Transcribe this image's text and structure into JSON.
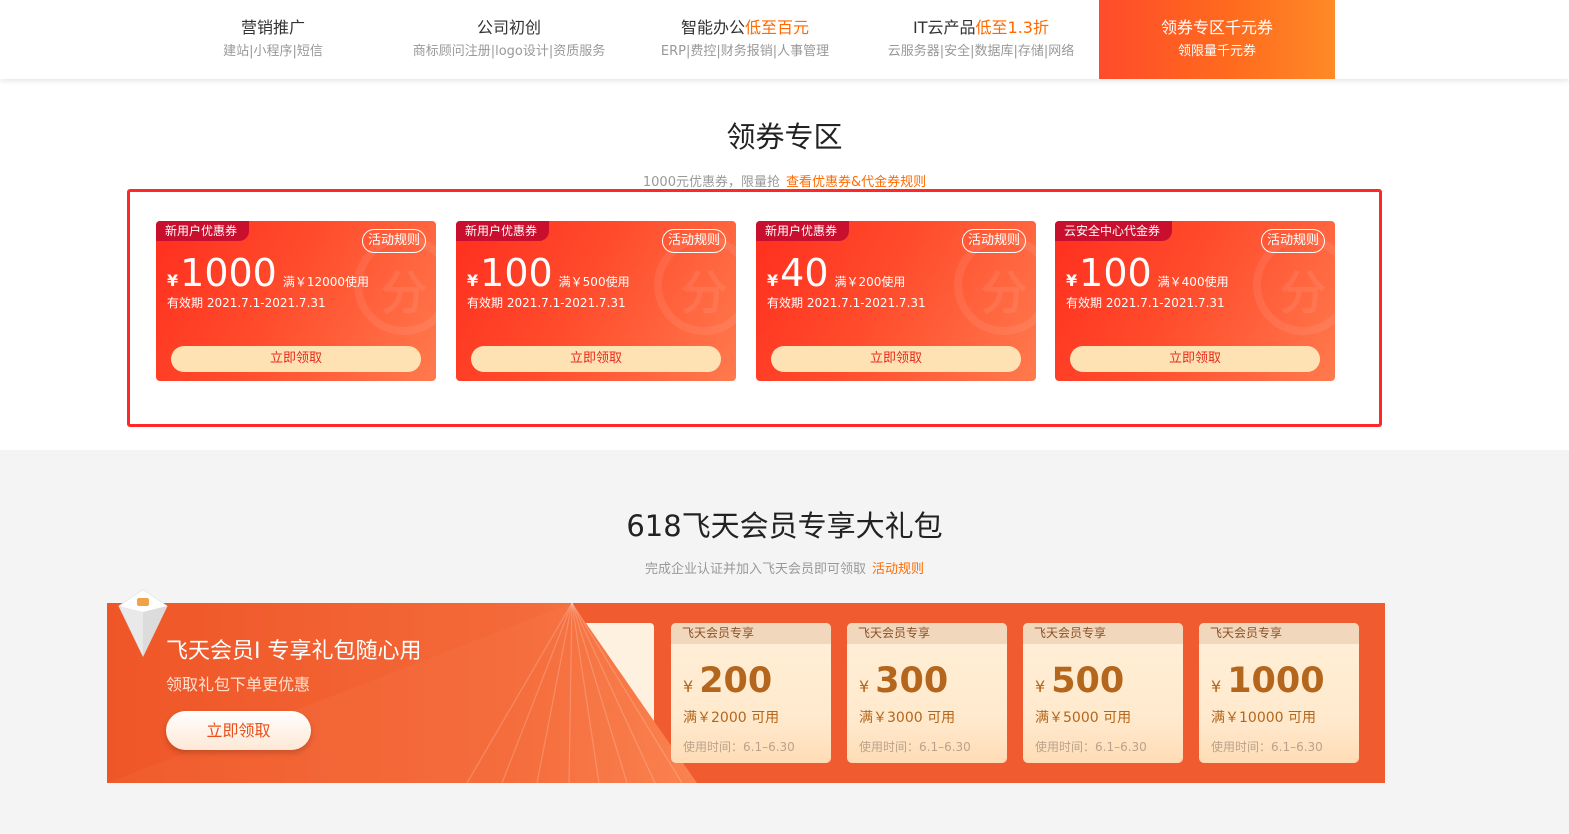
{
  "nav": {
    "items": [
      {
        "title": "营销推广",
        "highlight": "",
        "sub": "建站|小程序|短信"
      },
      {
        "title": "公司初创",
        "highlight": "",
        "sub": "商标顾问注册|logo设计|资质服务"
      },
      {
        "title": "智能办公",
        "highlight": "低至百元",
        "sub": "ERP|费控|财务报销|人事管理"
      },
      {
        "title": "IT云产品",
        "highlight": "低至1.3折",
        "sub": "云服务器|安全|数据库|存储|网络"
      },
      {
        "title": "领券专区千元券",
        "highlight": "",
        "sub": "领限量千元券"
      }
    ],
    "active_index": 4
  },
  "coupon_section": {
    "title": "领券专区",
    "subtitle": "1000元优惠券，限量抢",
    "rules_link": "查看优惠券&代金券规则"
  },
  "coupons": [
    {
      "tag": "新用户优惠券",
      "rule": "活动规则",
      "currency": "¥",
      "amount": "1000",
      "condition": "满￥12000使用",
      "valid": "有效期 2021.7.1-2021.7.31",
      "button": "立即领取"
    },
    {
      "tag": "新用户优惠券",
      "rule": "活动规则",
      "currency": "¥",
      "amount": "100",
      "condition": "满￥500使用",
      "valid": "有效期 2021.7.1-2021.7.31",
      "button": "立即领取"
    },
    {
      "tag": "新用户优惠券",
      "rule": "活动规则",
      "currency": "¥",
      "amount": "40",
      "condition": "满￥200使用",
      "valid": "有效期 2021.7.1-2021.7.31",
      "button": "立即领取"
    },
    {
      "tag": "云安全中心代金券",
      "rule": "活动规则",
      "currency": "¥",
      "amount": "100",
      "condition": "满￥400使用",
      "valid": "有效期 2021.7.1-2021.7.31",
      "button": "立即领取"
    }
  ],
  "member_section": {
    "title": "618飞天会员专享大礼包",
    "subtitle": "完成企业认证并加入飞天会员即可领取",
    "rules_link": "活动规则"
  },
  "banner": {
    "title": "飞天会员Ⅰ 专享礼包随心用",
    "subtitle": "领取礼包下单更优惠",
    "button": "立即领取"
  },
  "member_cards": [
    {
      "header": "飞天会员专享",
      "currency": "¥",
      "amount": "200",
      "condition": "满￥2000 可用",
      "time": "使用时间：6.1–6.30"
    },
    {
      "header": "飞天会员专享",
      "currency": "¥",
      "amount": "300",
      "condition": "满￥3000 可用",
      "time": "使用时间：6.1–6.30"
    },
    {
      "header": "飞天会员专享",
      "currency": "¥",
      "amount": "500",
      "condition": "满￥5000 可用",
      "time": "使用时间：6.1–6.30"
    },
    {
      "header": "飞天会员专享",
      "currency": "¥",
      "amount": "1000",
      "condition": "满￥10000 可用",
      "time": "使用时间：6.1–6.30"
    }
  ],
  "colors": {
    "accent": "#ff6a00",
    "coupon_red": "#ff3a24",
    "frame_red": "#ff2727",
    "banner_orange": "#f05c30",
    "gold_text": "#b3661c"
  }
}
